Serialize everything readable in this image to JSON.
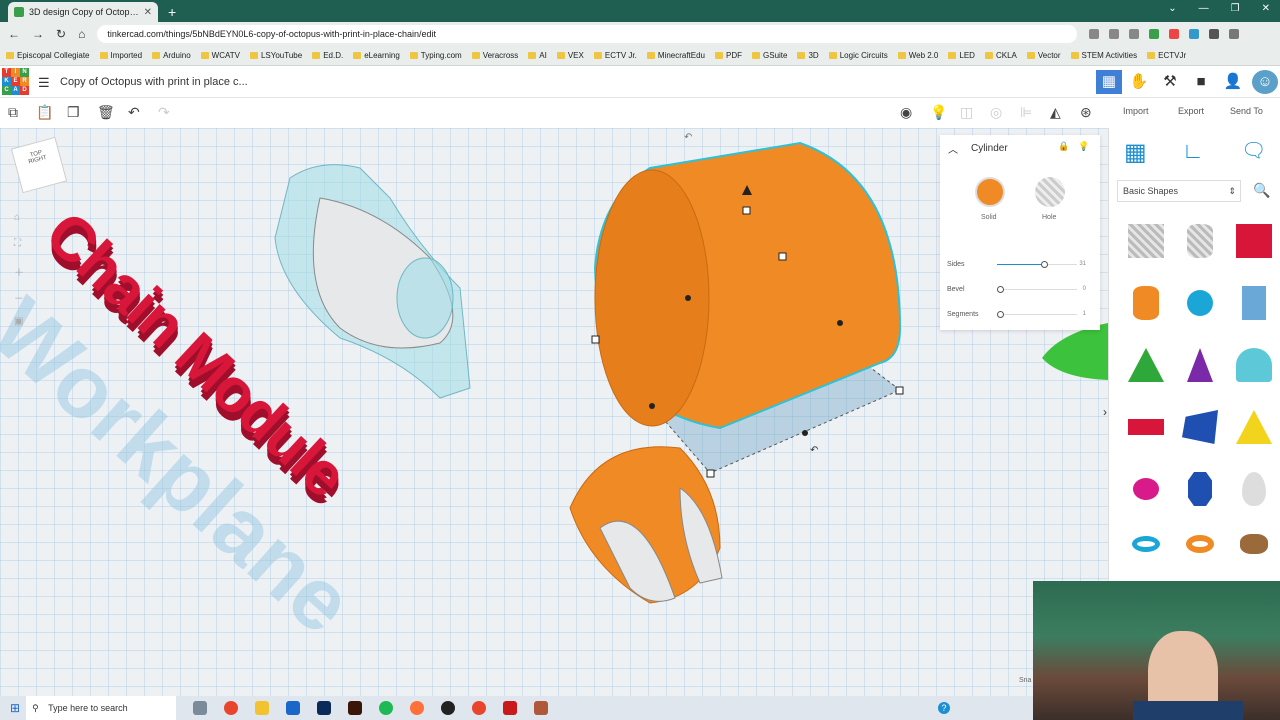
{
  "browser": {
    "tab_title": "3D design Copy of Octopus with",
    "tab_close": "✕",
    "new_tab": "+",
    "url": "tinkercad.com/things/5bNBdEYN0L6-copy-of-octopus-with-print-in-place-chain/edit",
    "window_controls": [
      "⌄",
      "—",
      "❐",
      "✕"
    ]
  },
  "bookmarks": [
    "Episcopal Collegiate",
    "Imported",
    "Arduino",
    "WCATV",
    "LSYouTube",
    "Ed.D.",
    "eLearning",
    "Typing.com",
    "Veracross",
    "AI",
    "VEX",
    "ECTV Jr.",
    "MinecraftEdu",
    "PDF",
    "GSuite",
    "3D",
    "Logic Circuits",
    "Web 2.0",
    "LED",
    "CKLA",
    "Vector",
    "STEM Activities",
    "ECTVJr"
  ],
  "app": {
    "logo_letters": [
      "TIN",
      "KER",
      "CAD"
    ],
    "design_title": "Copy of Octopus with print in place c..."
  },
  "toolbar": {
    "import": "Import",
    "export": "Export",
    "send_to": "Send To"
  },
  "workplane": {
    "watermark": "Workplane",
    "red_text": "Chain Module"
  },
  "viewcube": {
    "top": "TOP",
    "right": "RIGHT"
  },
  "inspector": {
    "title": "Cylinder",
    "solid_label": "Solid",
    "hole_label": "Hole",
    "props": [
      {
        "label": "Sides",
        "value": "31",
        "slider": 0.55
      },
      {
        "label": "Bevel",
        "value": "0",
        "slider": 0
      },
      {
        "label": "Segments",
        "value": "1",
        "slider": 0
      }
    ],
    "colors": {
      "solid": "#f08a24",
      "hole": "#bdbdbd"
    }
  },
  "shapes_panel": {
    "category": "Basic Shapes"
  },
  "taskbar": {
    "search_placeholder": "Type here to search"
  },
  "webcam": {
    "snap_hint": "Sna"
  }
}
